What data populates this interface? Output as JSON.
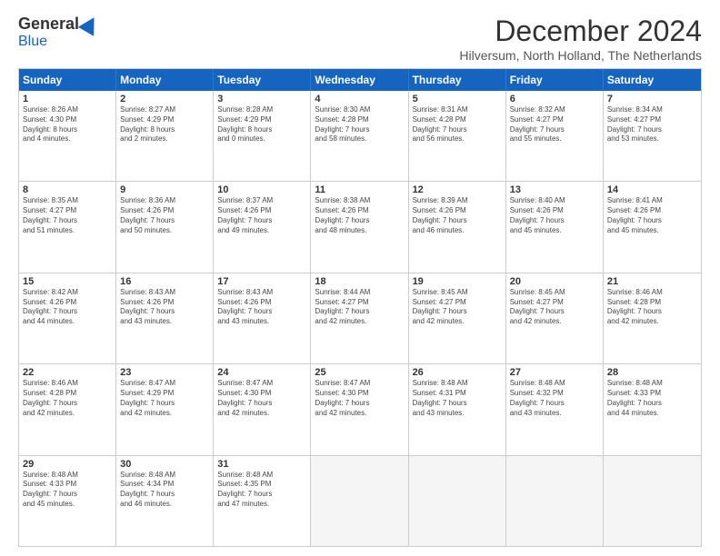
{
  "header": {
    "logo_general": "General",
    "logo_blue": "Blue",
    "main_title": "December 2024",
    "subtitle": "Hilversum, North Holland, The Netherlands"
  },
  "calendar": {
    "days": [
      "Sunday",
      "Monday",
      "Tuesday",
      "Wednesday",
      "Thursday",
      "Friday",
      "Saturday"
    ],
    "rows": [
      [
        {
          "day": "1",
          "text": "Sunrise: 8:26 AM\nSunset: 4:30 PM\nDaylight: 8 hours\nand 4 minutes."
        },
        {
          "day": "2",
          "text": "Sunrise: 8:27 AM\nSunset: 4:29 PM\nDaylight: 8 hours\nand 2 minutes."
        },
        {
          "day": "3",
          "text": "Sunrise: 8:28 AM\nSunset: 4:29 PM\nDaylight: 8 hours\nand 0 minutes."
        },
        {
          "day": "4",
          "text": "Sunrise: 8:30 AM\nSunset: 4:28 PM\nDaylight: 7 hours\nand 58 minutes."
        },
        {
          "day": "5",
          "text": "Sunrise: 8:31 AM\nSunset: 4:28 PM\nDaylight: 7 hours\nand 56 minutes."
        },
        {
          "day": "6",
          "text": "Sunrise: 8:32 AM\nSunset: 4:27 PM\nDaylight: 7 hours\nand 55 minutes."
        },
        {
          "day": "7",
          "text": "Sunrise: 8:34 AM\nSunset: 4:27 PM\nDaylight: 7 hours\nand 53 minutes."
        }
      ],
      [
        {
          "day": "8",
          "text": "Sunrise: 8:35 AM\nSunset: 4:27 PM\nDaylight: 7 hours\nand 51 minutes."
        },
        {
          "day": "9",
          "text": "Sunrise: 8:36 AM\nSunset: 4:26 PM\nDaylight: 7 hours\nand 50 minutes."
        },
        {
          "day": "10",
          "text": "Sunrise: 8:37 AM\nSunset: 4:26 PM\nDaylight: 7 hours\nand 49 minutes."
        },
        {
          "day": "11",
          "text": "Sunrise: 8:38 AM\nSunset: 4:26 PM\nDaylight: 7 hours\nand 48 minutes."
        },
        {
          "day": "12",
          "text": "Sunrise: 8:39 AM\nSunset: 4:26 PM\nDaylight: 7 hours\nand 46 minutes."
        },
        {
          "day": "13",
          "text": "Sunrise: 8:40 AM\nSunset: 4:26 PM\nDaylight: 7 hours\nand 45 minutes."
        },
        {
          "day": "14",
          "text": "Sunrise: 8:41 AM\nSunset: 4:26 PM\nDaylight: 7 hours\nand 45 minutes."
        }
      ],
      [
        {
          "day": "15",
          "text": "Sunrise: 8:42 AM\nSunset: 4:26 PM\nDaylight: 7 hours\nand 44 minutes."
        },
        {
          "day": "16",
          "text": "Sunrise: 8:43 AM\nSunset: 4:26 PM\nDaylight: 7 hours\nand 43 minutes."
        },
        {
          "day": "17",
          "text": "Sunrise: 8:43 AM\nSunset: 4:26 PM\nDaylight: 7 hours\nand 43 minutes."
        },
        {
          "day": "18",
          "text": "Sunrise: 8:44 AM\nSunset: 4:27 PM\nDaylight: 7 hours\nand 42 minutes."
        },
        {
          "day": "19",
          "text": "Sunrise: 8:45 AM\nSunset: 4:27 PM\nDaylight: 7 hours\nand 42 minutes."
        },
        {
          "day": "20",
          "text": "Sunrise: 8:45 AM\nSunset: 4:27 PM\nDaylight: 7 hours\nand 42 minutes."
        },
        {
          "day": "21",
          "text": "Sunrise: 8:46 AM\nSunset: 4:28 PM\nDaylight: 7 hours\nand 42 minutes."
        }
      ],
      [
        {
          "day": "22",
          "text": "Sunrise: 8:46 AM\nSunset: 4:28 PM\nDaylight: 7 hours\nand 42 minutes."
        },
        {
          "day": "23",
          "text": "Sunrise: 8:47 AM\nSunset: 4:29 PM\nDaylight: 7 hours\nand 42 minutes."
        },
        {
          "day": "24",
          "text": "Sunrise: 8:47 AM\nSunset: 4:30 PM\nDaylight: 7 hours\nand 42 minutes."
        },
        {
          "day": "25",
          "text": "Sunrise: 8:47 AM\nSunset: 4:30 PM\nDaylight: 7 hours\nand 42 minutes."
        },
        {
          "day": "26",
          "text": "Sunrise: 8:48 AM\nSunset: 4:31 PM\nDaylight: 7 hours\nand 43 minutes."
        },
        {
          "day": "27",
          "text": "Sunrise: 8:48 AM\nSunset: 4:32 PM\nDaylight: 7 hours\nand 43 minutes."
        },
        {
          "day": "28",
          "text": "Sunrise: 8:48 AM\nSunset: 4:33 PM\nDaylight: 7 hours\nand 44 minutes."
        }
      ],
      [
        {
          "day": "29",
          "text": "Sunrise: 8:48 AM\nSunset: 4:33 PM\nDaylight: 7 hours\nand 45 minutes."
        },
        {
          "day": "30",
          "text": "Sunrise: 8:48 AM\nSunset: 4:34 PM\nDaylight: 7 hours\nand 46 minutes."
        },
        {
          "day": "31",
          "text": "Sunrise: 8:48 AM\nSunset: 4:35 PM\nDaylight: 7 hours\nand 47 minutes."
        },
        {
          "day": "",
          "text": ""
        },
        {
          "day": "",
          "text": ""
        },
        {
          "day": "",
          "text": ""
        },
        {
          "day": "",
          "text": ""
        }
      ]
    ]
  }
}
